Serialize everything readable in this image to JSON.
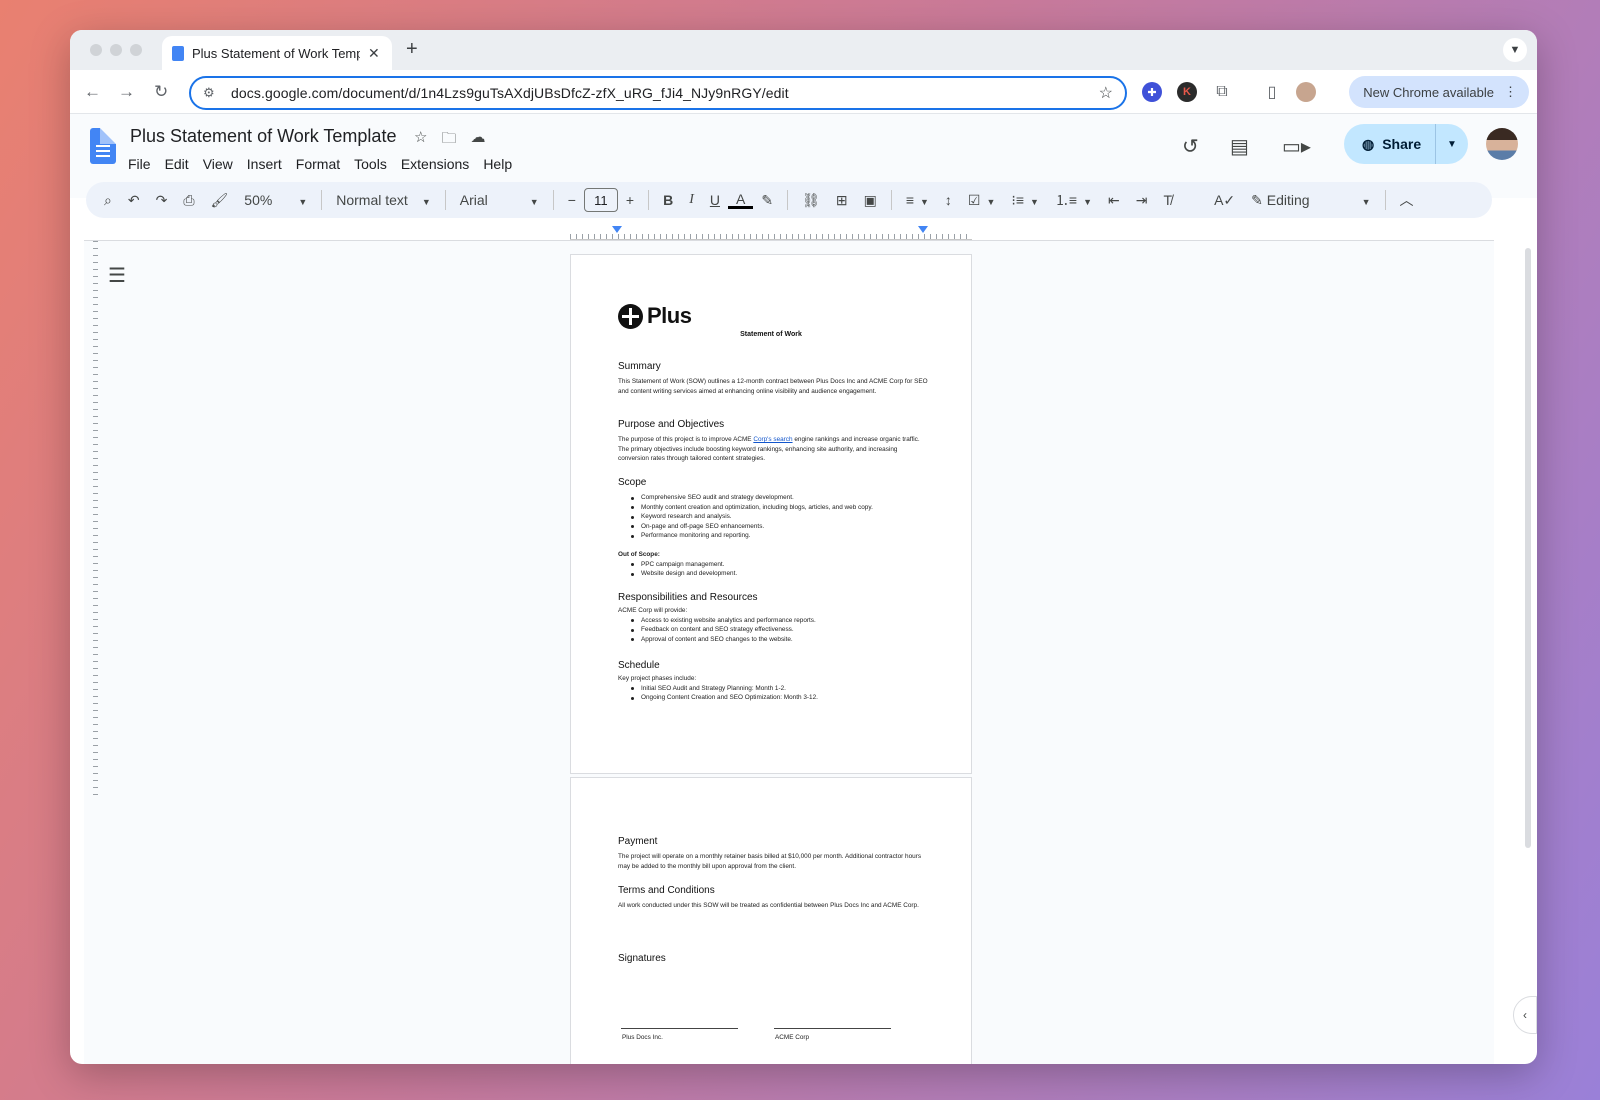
{
  "browser": {
    "tab_title": "Plus Statement of Work Temp",
    "url": "docs.google.com/document/d/1n4Lzs9guTsAXdjUBsDfcZ-zfX_uRG_fJi4_NJy9nRGY/edit",
    "new_chrome_label": "New Chrome available",
    "ext_k_label": "K"
  },
  "docs": {
    "title": "Plus Statement of Work Template",
    "menu": [
      "File",
      "Edit",
      "View",
      "Insert",
      "Format",
      "Tools",
      "Extensions",
      "Help"
    ],
    "share_label": "Share",
    "toolbar": {
      "zoom": "50%",
      "style": "Normal text",
      "font": "Arial",
      "font_size": "11",
      "mode": "Editing",
      "text_color_glyph": "A"
    }
  },
  "document": {
    "logo_text": "Plus",
    "sow_title": "Statement of Work",
    "summary_heading": "Summary",
    "summary_text": "This Statement of Work (SOW) outlines a 12-month contract between Plus Docs Inc and ACME Corp for SEO and content writing services aimed at enhancing online visibility and audience engagement.",
    "purpose_heading": "Purpose and Objectives",
    "purpose_text_1": "The purpose of this project is to improve ACME ",
    "purpose_link": "Corp's search",
    "purpose_text_2": " engine rankings and increase organic traffic. The primary objectives include boosting keyword rankings, enhancing site authority, and increasing conversion rates through tailored content strategies.",
    "scope_heading": "Scope",
    "scope_items": [
      "Comprehensive SEO audit and strategy development.",
      "Monthly content creation and optimization, including blogs, articles, and web copy.",
      "Keyword research and analysis.",
      "On-page and off-page SEO enhancements.",
      "Performance monitoring and reporting."
    ],
    "out_of_scope_label": "Out of Scope:",
    "out_of_scope_items": [
      "PPC campaign management.",
      "Website design and development."
    ],
    "resp_heading": "Responsibilities and Resources",
    "resp_intro": "ACME Corp will provide:",
    "resp_items": [
      "Access to existing website analytics and performance reports.",
      "Feedback on content and SEO strategy effectiveness.",
      "Approval of content and SEO changes to the website."
    ],
    "schedule_heading": "Schedule",
    "schedule_intro": "Key project phases include:",
    "schedule_items": [
      "Initial SEO Audit and Strategy Planning: Month 1-2.",
      "Ongoing Content Creation and SEO Optimization: Month 3-12."
    ],
    "payment_heading": "Payment",
    "payment_text": "The project will operate on a monthly retainer basis billed at $10,000 per month. Additional contractor hours may be added to the monthly bill upon approval from the client.",
    "terms_heading": "Terms and Conditions",
    "terms_text": "All work conducted under this SOW will be treated as confidential between Plus Docs Inc and ACME Corp.",
    "signatures_heading": "Signatures",
    "sig_left": "Plus Docs Inc.",
    "sig_right": "ACME Corp"
  }
}
